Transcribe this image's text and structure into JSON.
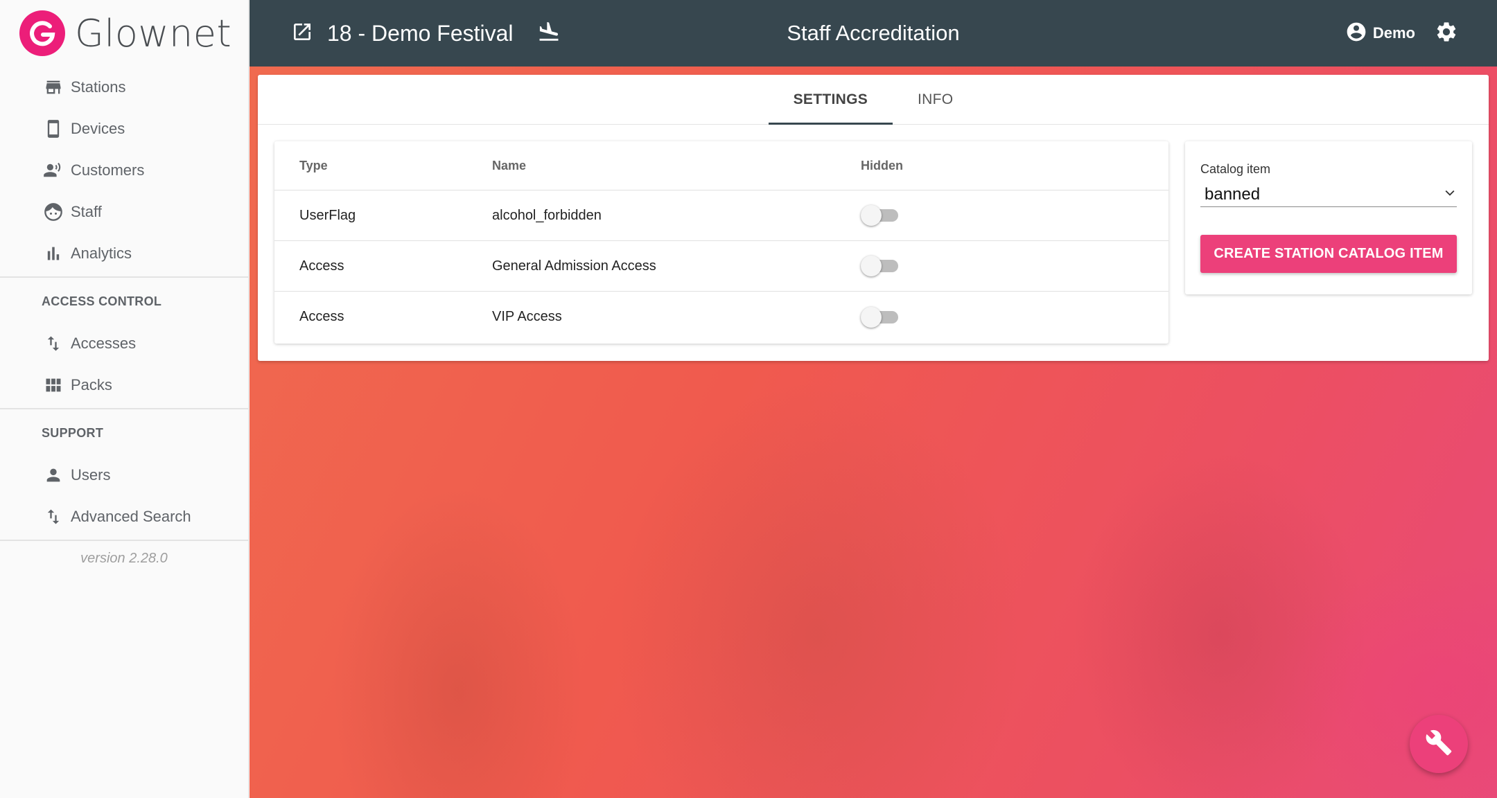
{
  "brand": {
    "name": "Glownet",
    "accent": "#ec1e79"
  },
  "sidebar": {
    "main_items": [
      {
        "label": "Stations",
        "icon": "store-icon"
      },
      {
        "label": "Devices",
        "icon": "smartphone-icon"
      },
      {
        "label": "Customers",
        "icon": "customers-icon"
      },
      {
        "label": "Staff",
        "icon": "face-icon"
      },
      {
        "label": "Analytics",
        "icon": "bar-chart-icon"
      }
    ],
    "access_control": {
      "title": "ACCESS CONTROL",
      "items": [
        {
          "label": "Accesses",
          "icon": "swap-vertical-icon"
        },
        {
          "label": "Packs",
          "icon": "grid-icon"
        }
      ]
    },
    "support": {
      "title": "SUPPORT",
      "items": [
        {
          "label": "Users",
          "icon": "person-icon"
        },
        {
          "label": "Advanced Search",
          "icon": "swap-vertical-icon"
        }
      ]
    },
    "version": "version 2.28.0"
  },
  "header": {
    "event_name": "18 - Demo Festival",
    "page_title": "Staff Accreditation",
    "user_name": "Demo",
    "bg_color": "#37474f"
  },
  "tabs": [
    {
      "label": "SETTINGS",
      "active": true
    },
    {
      "label": "INFO",
      "active": false
    }
  ],
  "table": {
    "headers": {
      "type": "Type",
      "name": "Name",
      "hidden": "Hidden"
    },
    "rows": [
      {
        "type": "UserFlag",
        "name": "alcohol_forbidden",
        "hidden": false
      },
      {
        "type": "Access",
        "name": "General Admission Access",
        "hidden": false
      },
      {
        "type": "Access",
        "name": "VIP Access",
        "hidden": false
      }
    ]
  },
  "catalog": {
    "label": "Catalog item",
    "selected": "banned",
    "button_label": "CREATE STATION CATALOG ITEM",
    "button_color": "#ec407a"
  },
  "fab": {
    "icon": "wrench-icon"
  }
}
